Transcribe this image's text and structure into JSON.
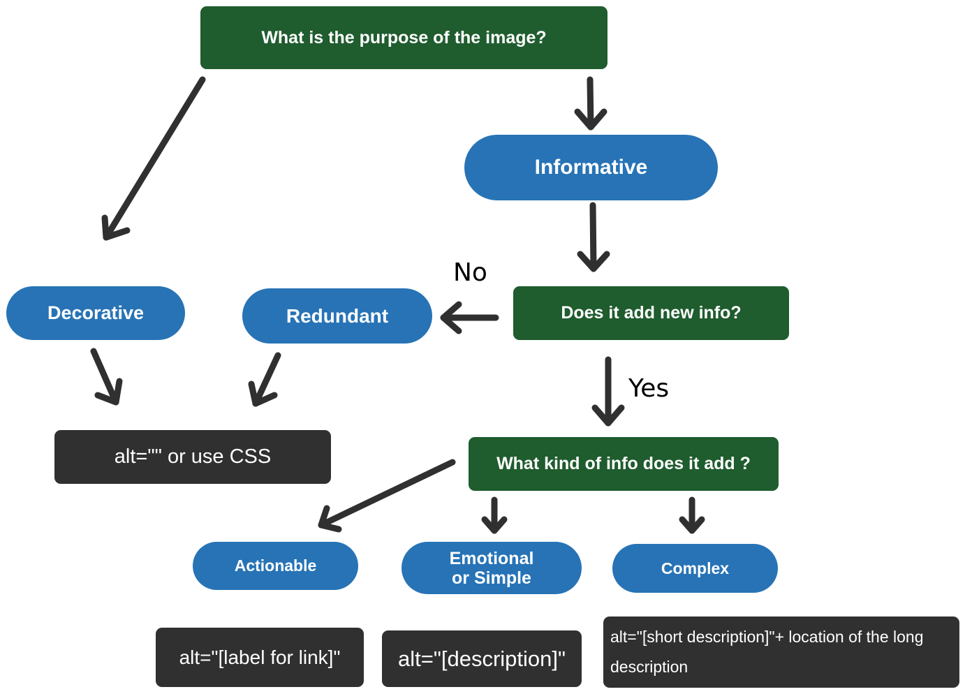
{
  "colors": {
    "question": "#1f5c2e",
    "category": "#2773b6",
    "result": "#303030",
    "arrow": "#303030"
  },
  "nodes": {
    "purpose": "What is the purpose of the image?",
    "informative": "Informative",
    "new_info": "Does it add new info?",
    "decorative": "Decorative",
    "redundant": "Redundant",
    "alt_empty": "alt=\"\" or use CSS",
    "kind_of_info": "What kind of info does it add ?",
    "actionable": "Actionable",
    "emotional": "Emotional or Simple",
    "complex": "Complex",
    "alt_label": "alt=\"[label for link]\"",
    "alt_description": "alt=\"[description]\"",
    "alt_long": "alt=\"[short description]\"+ location of the long description"
  },
  "edge_labels": {
    "no": "No",
    "yes": "Yes"
  }
}
